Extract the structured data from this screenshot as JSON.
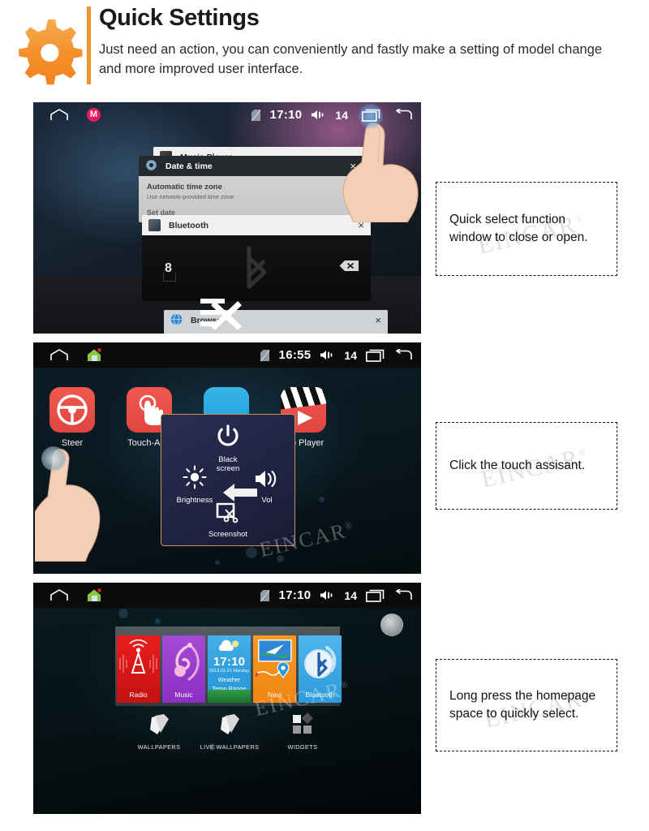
{
  "header": {
    "icon": "gear-icon",
    "title": "Quick Settings",
    "subtitle": "Just need an action, you can conveniently and fastly make a setting of model change and more improved user interface.",
    "accent_color": "#f0952a"
  },
  "watermark": {
    "text": "EINCAR",
    "mark": "®"
  },
  "panels": [
    {
      "name": "recent-apps-panel",
      "statusbar": {
        "home_icon": "home-outline-icon",
        "app_badge_icon": "gmail-icon",
        "app_badge_letter": "M",
        "sim_icon": "no-sim-icon",
        "time": "17:10",
        "volume_icon": "volume-icon",
        "volume_level": "14",
        "recents_icon": "recent-apps-icon",
        "back_icon": "back-arrow-icon"
      },
      "cards": [
        {
          "title": "Music Player",
          "icon": "music-player-icon",
          "close": "×"
        },
        {
          "title": "Date & time",
          "icon": "settings-gear-icon",
          "close": "×",
          "row1": "Automatic time zone",
          "row2": "Use network-provided time zone",
          "row3": "Set date"
        },
        {
          "title": "Bluetooth",
          "icon": "bluetooth-app-icon",
          "close": "×",
          "pin": "8",
          "backspace_icon": "backspace-icon"
        },
        {
          "title": "Browser",
          "icon": "browser-globe-icon",
          "close": "×"
        }
      ],
      "close_all_icon": "close-all-icon",
      "hand_icon": "pointing-hand-icon",
      "caption": "Quick select function window  to close or open."
    },
    {
      "name": "touch-assistant-panel",
      "statusbar": {
        "home_icon": "home-outline-icon",
        "app_badge_icon": "home-app-icon",
        "sim_icon": "no-sim-icon",
        "time": "16:55",
        "volume_icon": "volume-icon",
        "volume_level": "14",
        "recents_icon": "recent-apps-icon",
        "back_icon": "back-arrow-icon"
      },
      "apps": [
        {
          "label": "Steer",
          "icon": "steering-wheel-icon",
          "color": "#e8504a"
        },
        {
          "label": "Touch-Assi",
          "icon": "touch-assistant-icon",
          "color": "#e8504a"
        },
        {
          "label": "",
          "icon": "blue-app-icon",
          "color": "#2d9fdc"
        },
        {
          "label": "o Player",
          "icon": "video-player-icon",
          "color": "#e8504a"
        }
      ],
      "assistant": {
        "items": [
          {
            "label": "Black\nscreen",
            "label_line1": "Black",
            "label_line2": "screen",
            "icon": "power-icon"
          },
          {
            "label": "Brightness",
            "icon": "brightness-sun-icon"
          },
          {
            "label": "Vol",
            "icon": "volume-up-icon"
          },
          {
            "label": "Screenshot",
            "icon": "screenshot-icon"
          },
          {
            "label": "",
            "icon": "back-arrow-large-icon"
          }
        ]
      },
      "hand_icon": "pointing-hand-icon",
      "caption": "Click the touch assisant."
    },
    {
      "name": "home-long-press-panel",
      "statusbar": {
        "home_icon": "home-outline-icon",
        "app_badge_icon": "home-app-icon",
        "sim_icon": "no-sim-icon",
        "time": "17:10",
        "volume_icon": "volume-icon",
        "volume_level": "14",
        "recents_icon": "recent-apps-icon",
        "back_icon": "back-arrow-icon"
      },
      "widgets": [
        {
          "label": "Radio",
          "icon": "radio-tower-icon",
          "color": "#d91616"
        },
        {
          "label": "Music",
          "icon": "music-note-icon",
          "color": "#9a38cb"
        },
        {
          "label": "",
          "icon": "weather-icon",
          "color": "#2e9bdb",
          "time": "17:10",
          "date": "2013.01.21 Monday",
          "line1": "Weather",
          "line2": "Temp Range"
        },
        {
          "label": "Navi",
          "icon": "navigation-map-icon",
          "color": "#f08b16"
        },
        {
          "label": "Bluetooth",
          "icon": "bluetooth-icon",
          "color": "#2d9ad9"
        }
      ],
      "options": [
        {
          "label": "WALLPAPERS",
          "icon": "wallpapers-icon"
        },
        {
          "label": "LIVE WALLPAPERS",
          "icon": "live-wallpapers-icon"
        },
        {
          "label": "WIDGETS",
          "icon": "widgets-icon"
        }
      ],
      "knob_icon": "rotary-knob-icon",
      "caption": "Long press the homepage space to quickly select."
    }
  ]
}
